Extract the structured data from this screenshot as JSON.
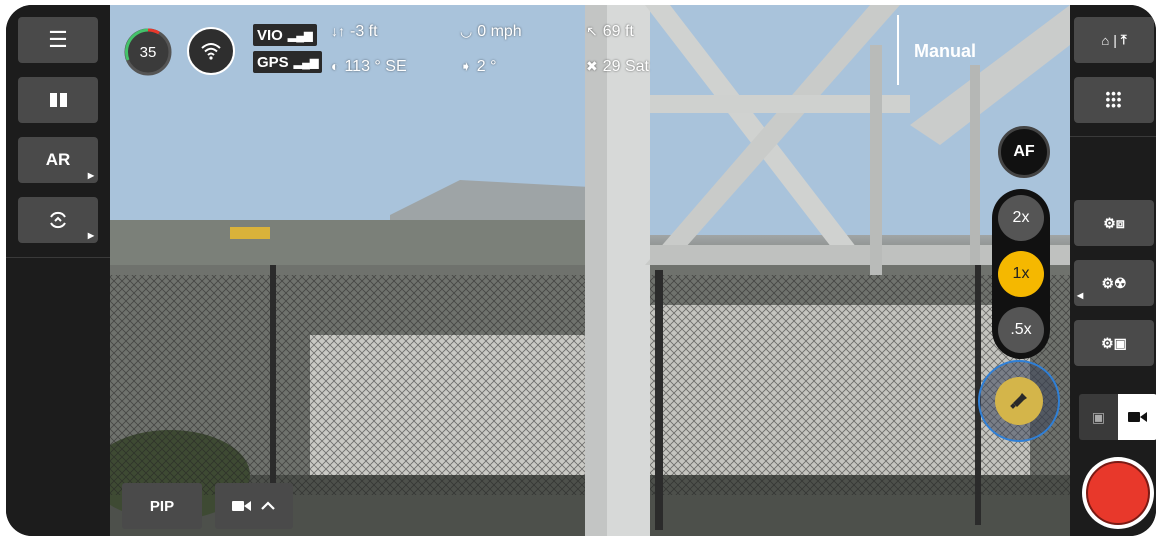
{
  "telemetry": {
    "battery": "35",
    "altitude": "-3 ft",
    "speed": "0 mph",
    "distance": "69 ft",
    "heading": "113 ° SE",
    "gimbal": "2 °",
    "satellites": "29 Sat",
    "vio_label": "VIO",
    "gps_label": "GPS"
  },
  "flight_mode": "Manual",
  "left_rail": {
    "ar_label": "AR"
  },
  "zoom": {
    "af": "AF",
    "options": [
      "2x",
      "1x",
      ".5x"
    ],
    "selected": "1x"
  },
  "bottom": {
    "pip_label": "PIP"
  },
  "colors": {
    "accent": "#f5b800",
    "record": "#e8382b",
    "focus_ring": "#2f7fd6",
    "battery_arc": "#44c26a"
  }
}
